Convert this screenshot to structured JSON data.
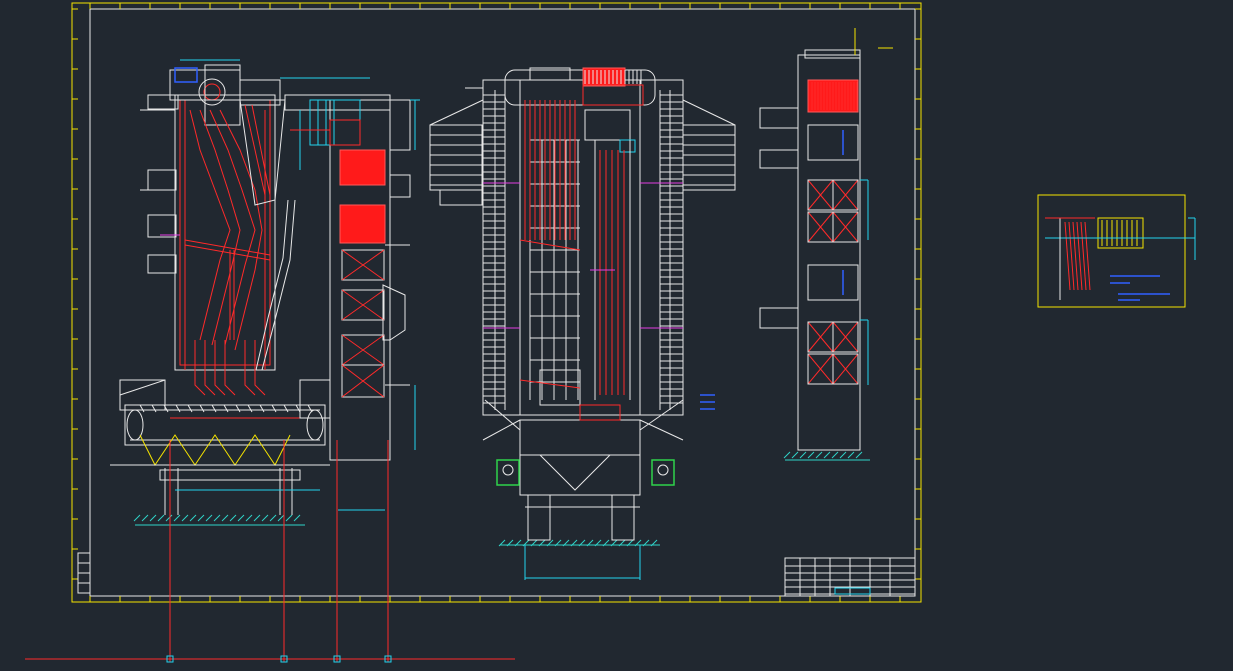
{
  "drawing": {
    "background": "#212830",
    "colors": {
      "white": "#e8e8e8",
      "red": "#ff2a2a",
      "cyan": "#22d3ee",
      "yellow": "#f5e400",
      "green": "#2fd34a",
      "magenta": "#e23ee2",
      "blue": "#3060ff"
    },
    "views": [
      "side-elevation",
      "front-elevation",
      "rear-elevation",
      "detail-inset"
    ],
    "title_block": {
      "text": ""
    }
  }
}
